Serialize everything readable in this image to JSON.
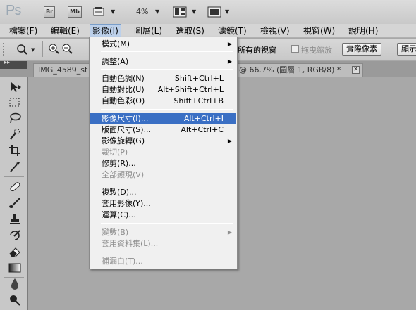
{
  "appbar": {
    "logo": "Ps",
    "bridge_label": "Br",
    "minibridge_label": "Mb",
    "zoom": "4%"
  },
  "menubar": [
    "檔案(F)",
    "編輯(E)",
    "影像(I)",
    "圖層(L)",
    "選取(S)",
    "濾鏡(T)",
    "檢視(V)",
    "視窗(W)",
    "說明(H)"
  ],
  "options": {
    "fit_label": "所有的視窗",
    "scrubby_label": "拖曳縮放",
    "actual_pixels": "實際像素",
    "fit_screen": "顯示"
  },
  "tabs": {
    "doc_name": "IMG_4589_st",
    "doc_info": "@ 66.7% (圖層 1, RGB/8) *"
  },
  "image_menu": {
    "mode": "模式(M)",
    "adjustments": "調整(A)",
    "auto_tone": "自動色調(N)",
    "auto_tone_sc": "Shift+Ctrl+L",
    "auto_contrast": "自動對比(U)",
    "auto_contrast_sc": "Alt+Shift+Ctrl+L",
    "auto_color": "自動色彩(O)",
    "auto_color_sc": "Shift+Ctrl+B",
    "image_size": "影像尺寸(I)...",
    "image_size_sc": "Alt+Ctrl+I",
    "canvas_size": "版面尺寸(S)...",
    "canvas_size_sc": "Alt+Ctrl+C",
    "rotation": "影像旋轉(G)",
    "crop": "裁切(P)",
    "trim": "修剪(R)...",
    "reveal_all": "全部顯現(V)",
    "duplicate": "複製(D)...",
    "apply_image": "套用影像(Y)...",
    "calculations": "運算(C)...",
    "variables": "變數(B)",
    "apply_data": "套用資料集(L)...",
    "trap": "補漏白(T)..."
  }
}
